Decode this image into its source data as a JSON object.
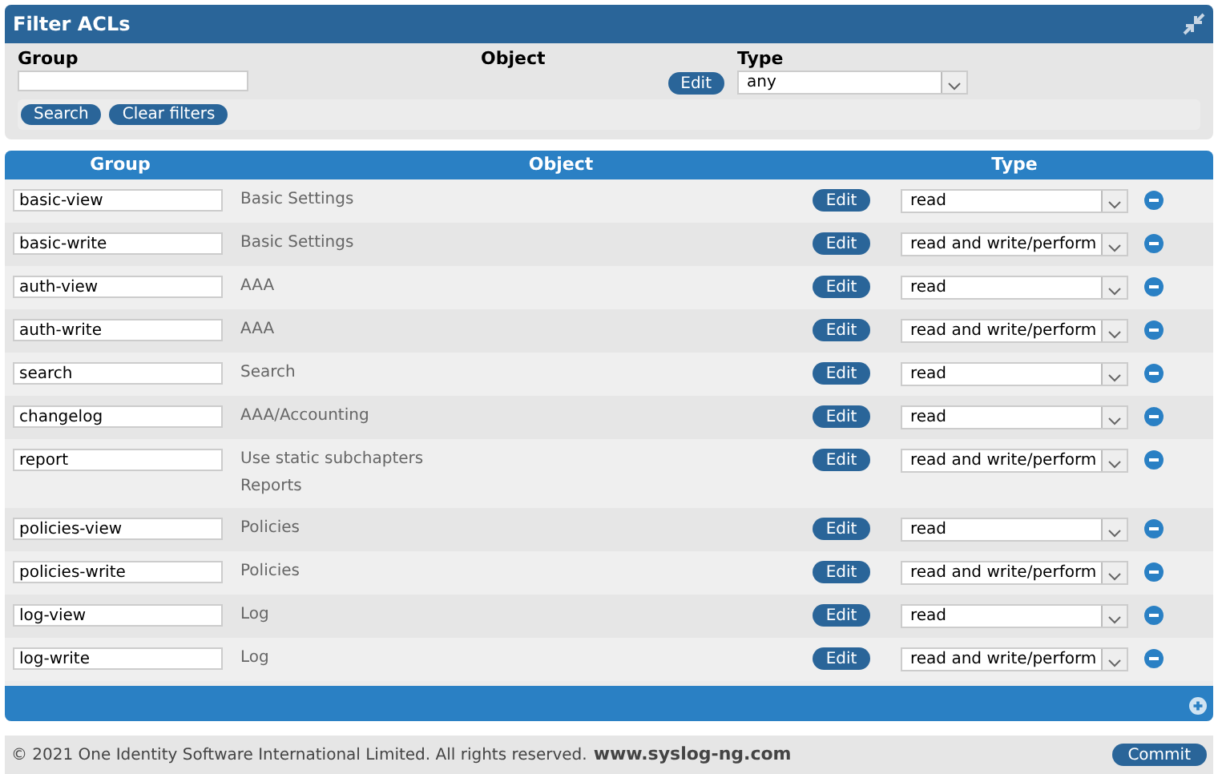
{
  "filter": {
    "title": "Filter ACLs",
    "group_label": "Group",
    "object_label": "Object",
    "object_edit": "Edit",
    "type_label": "Type",
    "type_value": "any",
    "buttons": [
      "Search",
      "Clear filters"
    ]
  },
  "table": {
    "columns": [
      "Group",
      "Object",
      "Type"
    ],
    "rows": [
      {
        "group": "basic-view",
        "object": [
          "Basic Settings"
        ],
        "edit": "Edit",
        "type": "read"
      },
      {
        "group": "basic-write",
        "object": [
          "Basic Settings"
        ],
        "edit": "Edit",
        "type": "read and write/perform"
      },
      {
        "group": "auth-view",
        "object": [
          "AAA"
        ],
        "edit": "Edit",
        "type": "read"
      },
      {
        "group": "auth-write",
        "object": [
          "AAA"
        ],
        "edit": "Edit",
        "type": "read and write/perform"
      },
      {
        "group": "search",
        "object": [
          "Search"
        ],
        "edit": "Edit",
        "type": "read"
      },
      {
        "group": "changelog",
        "object": [
          "AAA/Accounting"
        ],
        "edit": "Edit",
        "type": "read"
      },
      {
        "group": "report",
        "object": [
          "Use static subchapters",
          "Reports"
        ],
        "edit": "Edit",
        "type": "read and write/perform"
      },
      {
        "group": "policies-view",
        "object": [
          "Policies"
        ],
        "edit": "Edit",
        "type": "read"
      },
      {
        "group": "policies-write",
        "object": [
          "Policies"
        ],
        "edit": "Edit",
        "type": "read and write/perform"
      },
      {
        "group": "log-view",
        "object": [
          "Log"
        ],
        "edit": "Edit",
        "type": "read"
      },
      {
        "group": "log-write",
        "object": [
          "Log"
        ],
        "edit": "Edit",
        "type": "read and write/perform"
      }
    ]
  },
  "footer": {
    "copyright": "© 2021 One Identity Software International Limited. All rights reserved.",
    "link": "www.syslog-ng.com",
    "commit": "Commit"
  }
}
